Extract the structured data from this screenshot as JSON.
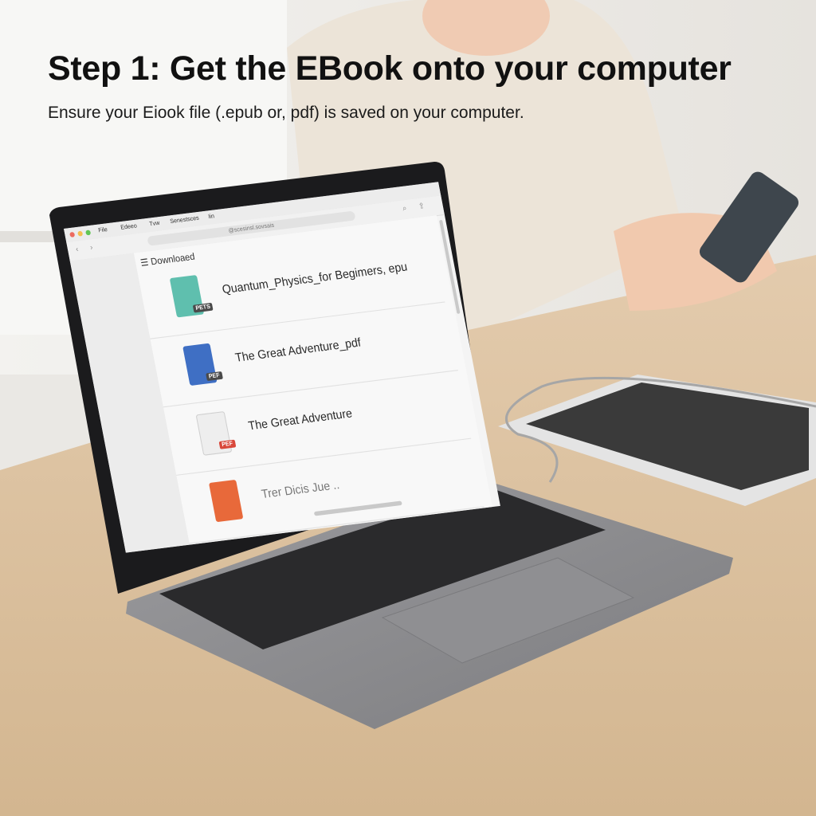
{
  "caption": {
    "title": "Step 1: Get the EBook onto your computer",
    "subtitle": "Ensure your Eiook file (.epub or, pdf) is saved on your computer."
  },
  "screen": {
    "menu": [
      "File",
      "Edeeo",
      "Tvw",
      "Senestsces",
      "Iin"
    ],
    "url_text": "@scesinsl.sovsais",
    "folder": "Downloaed",
    "files": [
      {
        "name": "Quantum_Physics_for Begimers, epu",
        "badge": "PETS",
        "color": "#5fbfae",
        "badge_color": "#4a4a4a"
      },
      {
        "name": "The Great Adventure_pdf",
        "badge": "PEF",
        "color": "#3f6fc4",
        "badge_color": "#4a4a4a"
      },
      {
        "name": "The Great Adventure",
        "badge": "PEF",
        "color": "#eeeeee",
        "badge_color": "#d9483b"
      },
      {
        "name": "Trer Dicis Jue ..",
        "badge": "",
        "color": "#e8693a",
        "badge_color": "#d9483b"
      }
    ]
  },
  "colors": {
    "laptop_body": "#8c8c8e",
    "keyboard": "#2a2a2c",
    "desk": "#dcc3a4",
    "wall": "#ece9e4"
  }
}
